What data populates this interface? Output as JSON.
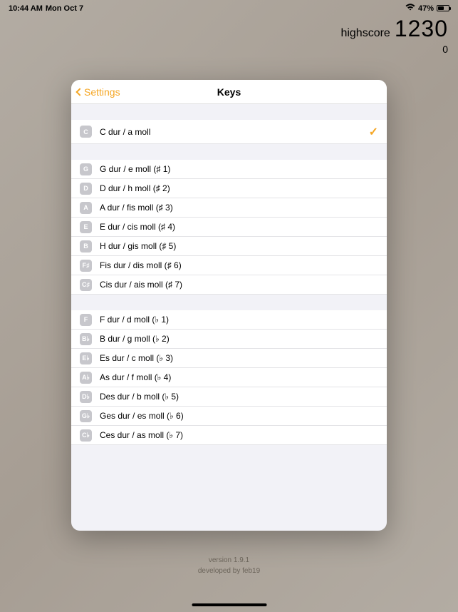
{
  "statusBar": {
    "time": "10:44 AM",
    "date": "Mon Oct 7",
    "batteryPercent": "47%"
  },
  "score": {
    "highscoreLabel": "highscore",
    "highscoreValue": "1230",
    "currentScore": "0"
  },
  "modal": {
    "backLabel": "Settings",
    "title": "Keys",
    "groups": [
      [
        {
          "badge": "C",
          "label": "C dur / a moll",
          "selected": true
        }
      ],
      [
        {
          "badge": "G",
          "label": "G dur / e moll (♯ 1)",
          "selected": false
        },
        {
          "badge": "D",
          "label": "D dur / h moll (♯ 2)",
          "selected": false
        },
        {
          "badge": "A",
          "label": "A dur / fis moll (♯ 3)",
          "selected": false
        },
        {
          "badge": "E",
          "label": "E dur / cis moll (♯ 4)",
          "selected": false
        },
        {
          "badge": "B",
          "label": "H dur / gis moll (♯ 5)",
          "selected": false
        },
        {
          "badge": "F♯",
          "label": "Fis dur / dis moll (♯ 6)",
          "selected": false
        },
        {
          "badge": "C♯",
          "label": "Cis dur / ais moll (♯ 7)",
          "selected": false
        }
      ],
      [
        {
          "badge": "F",
          "label": "F dur / d moll (♭ 1)",
          "selected": false
        },
        {
          "badge": "B♭",
          "label": "B dur / g moll (♭ 2)",
          "selected": false
        },
        {
          "badge": "E♭",
          "label": "Es dur / c moll (♭ 3)",
          "selected": false
        },
        {
          "badge": "A♭",
          "label": "As dur / f moll (♭ 4)",
          "selected": false
        },
        {
          "badge": "D♭",
          "label": "Des dur / b moll (♭ 5)",
          "selected": false
        },
        {
          "badge": "G♭",
          "label": "Ges dur / es moll (♭ 6)",
          "selected": false
        },
        {
          "badge": "C♭",
          "label": "Ces dur / as moll (♭ 7)",
          "selected": false
        }
      ]
    ]
  },
  "footer": {
    "version": "version 1.9.1",
    "developer": "developed by feb19"
  }
}
